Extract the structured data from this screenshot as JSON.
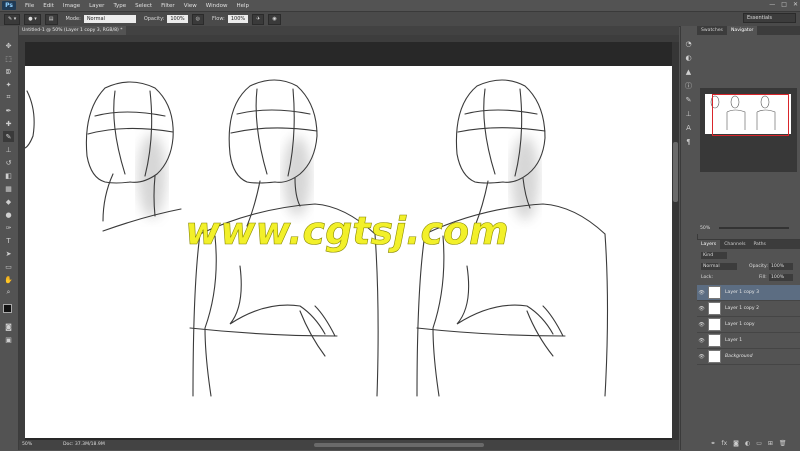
{
  "app": {
    "logo": "Ps"
  },
  "menu": [
    "File",
    "Edit",
    "Image",
    "Layer",
    "Type",
    "Select",
    "Filter",
    "View",
    "Window",
    "Help"
  ],
  "window_controls": [
    "—",
    "□",
    "✕"
  ],
  "options_bar": {
    "mode_label": "Mode:",
    "mode_value": "Normal",
    "opacity_label": "Opacity:",
    "opacity_value": "100%",
    "flow_label": "Flow:",
    "flow_value": "100%",
    "workspace": "Essentials"
  },
  "document": {
    "tab_title": "Untitled-1 @ 50% (Layer 1 copy 3, RGB/8) *",
    "watermark": "www.cgtsj.com",
    "watermark_color": "#f2f02a"
  },
  "status": {
    "zoom": "50%",
    "doc_size": "Doc: 37.3M/18.9M"
  },
  "navigator": {
    "tabs": [
      "Swatches",
      "Navigator"
    ],
    "active_tab": "Navigator",
    "zoom": "50%",
    "view_box_color": "#d9262b"
  },
  "layers_panel": {
    "tabs": [
      "Layers",
      "Channels",
      "Paths"
    ],
    "active_tab": "Layers",
    "kind": "Kind",
    "blend_mode": "Normal",
    "opacity_label": "Opacity:",
    "opacity_value": "100%",
    "lock_label": "Lock:",
    "fill_label": "Fill:",
    "fill_value": "100%",
    "layers": [
      {
        "name": "Layer 1 copy 3",
        "selected": true
      },
      {
        "name": "Layer 1 copy 2",
        "selected": false
      },
      {
        "name": "Layer 1 copy",
        "selected": false
      },
      {
        "name": "Layer 1",
        "selected": false
      },
      {
        "name": "Background",
        "selected": false
      }
    ]
  },
  "tools": [
    "move-tool",
    "marquee-tool",
    "lasso-tool",
    "quick-select-tool",
    "crop-tool",
    "eyedropper-tool",
    "healing-tool",
    "brush-tool",
    "stamp-tool",
    "history-brush-tool",
    "eraser-tool",
    "gradient-tool",
    "blur-tool",
    "dodge-tool",
    "pen-tool",
    "type-tool",
    "path-select-tool",
    "shape-tool",
    "hand-tool",
    "zoom-tool"
  ]
}
